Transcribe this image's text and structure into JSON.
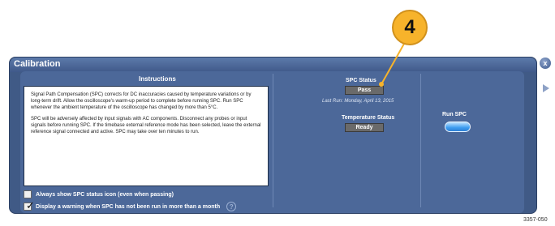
{
  "callout": {
    "number": "4"
  },
  "window": {
    "title": "Calibration",
    "close_label": "x"
  },
  "instructions": {
    "heading": "Instructions",
    "paragraph1": "Signal Path Compensation (SPC) corrects for DC inaccuracies caused by temperature variations or by long-term drift. Allow the oscilloscope's warm-up period to complete before running SPC. Run SPC whenever the ambient temperature of the oscilloscope has changed by more than 5°C.",
    "paragraph2": "SPC will be adversely affected by input signals with AC components. Disconnect any probes or input signals before running SPC. If the timebase external reference mode has been selected, leave the external reference signal connected and active. SPC may take over ten minutes to run."
  },
  "checkboxes": {
    "always_show": {
      "label": "Always show SPC status icon (even when passing)",
      "checked": false
    },
    "warning": {
      "label": "Display a warning when SPC has not been run in more than a month",
      "checked": true
    }
  },
  "spc_status": {
    "label": "SPC Status",
    "value": "Pass",
    "last_run": "Last Run: Monday, April 13, 2015"
  },
  "temperature_status": {
    "label": "Temperature Status",
    "value": "Ready"
  },
  "run_spc": {
    "label": "Run SPC"
  },
  "figure_number": "3357-050",
  "colors": {
    "window_bg": "#405a86",
    "panel_bg": "#4c6899",
    "callout": "#f7b32b",
    "status_box": "#6a6a6a",
    "run_button": "#3d9cf0"
  },
  "icons": {
    "close": "close-icon",
    "help": "help-icon",
    "nav_left": "triangle-left-icon",
    "nav_right": "triangle-right-icon"
  }
}
